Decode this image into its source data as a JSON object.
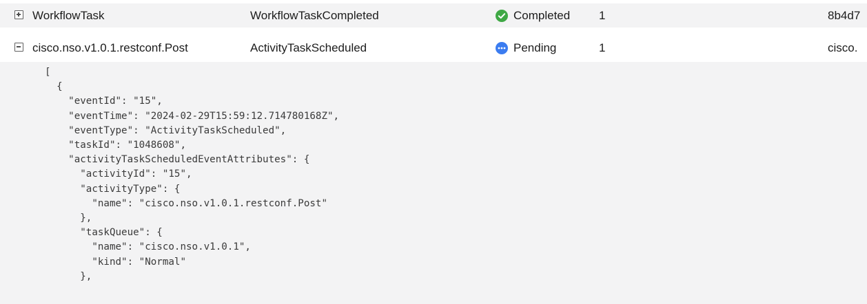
{
  "rows": [
    {
      "toggle": "expand",
      "name": "WorkflowTask",
      "event": "WorkflowTaskCompleted",
      "status": {
        "label": "Completed",
        "icon": "check-circle-icon",
        "color": "#3fa845"
      },
      "count": "1",
      "id": "8b4d7"
    },
    {
      "toggle": "collapse",
      "name": "cisco.nso.v1.0.1.restconf.Post",
      "event": "ActivityTaskScheduled",
      "status": {
        "label": "Pending",
        "icon": "more-dots-icon",
        "color": "#3b7cf0"
      },
      "count": "1",
      "id": "cisco."
    }
  ],
  "json_text": "[\n  {\n    \"eventId\": \"15\",\n    \"eventTime\": \"2024-02-29T15:59:12.714780168Z\",\n    \"eventType\": \"ActivityTaskScheduled\",\n    \"taskId\": \"1048608\",\n    \"activityTaskScheduledEventAttributes\": {\n      \"activityId\": \"15\",\n      \"activityType\": {\n        \"name\": \"cisco.nso.v1.0.1.restconf.Post\"\n      },\n      \"taskQueue\": {\n        \"name\": \"cisco.nso.v1.0.1\",\n        \"kind\": \"Normal\"\n      },"
}
